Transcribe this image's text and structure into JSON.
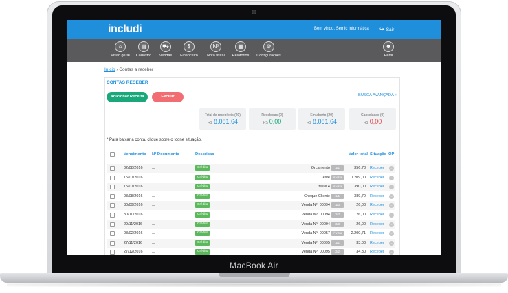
{
  "device": {
    "label": "MacBook Air"
  },
  "header": {
    "logo": "includi",
    "welcome": "Bem vindo, Semic Informática",
    "logout_label": "Sair"
  },
  "nav": [
    {
      "label": "Visão geral",
      "icon": "home-icon",
      "glyph": "⌂"
    },
    {
      "label": "Cadastro",
      "icon": "contacts-icon",
      "glyph": "▤"
    },
    {
      "label": "Vendas",
      "icon": "cart-icon",
      "glyph": "⛟"
    },
    {
      "label": "Financeiro",
      "icon": "dollar-icon",
      "glyph": "$"
    },
    {
      "label": "Nota fiscal",
      "icon": "invoice-icon",
      "glyph": "Nº"
    },
    {
      "label": "Relatórios",
      "icon": "reports-icon",
      "glyph": "▦"
    },
    {
      "label": "Configurações",
      "icon": "gear-icon",
      "glyph": "⚙"
    },
    {
      "label": "Perfil",
      "icon": "profile-icon",
      "glyph": "☻"
    }
  ],
  "breadcrumb": {
    "home": "Início",
    "current": "› Contas a receber"
  },
  "page": {
    "title": "CONTAS RECEBER",
    "add_button": "Adicionar Receita",
    "delete_button": "Excluir",
    "advanced_search": "BUSCA AVANÇADA +",
    "hint": "* Para baixar a conta, clique sobre o ícone situação."
  },
  "summary": [
    {
      "title": "Total de recebíveis (20)",
      "currency": "R$",
      "value": "8.081,64",
      "color": "#1f8fdc"
    },
    {
      "title": "Recebidas (0)",
      "currency": "R$",
      "value": "0,00",
      "color": "#1aa87a"
    },
    {
      "title": "Em aberto (20)",
      "currency": "R$",
      "value": "8.081,64",
      "color": "#1f8fdc"
    },
    {
      "title": "Canceladas (0)",
      "currency": "R$",
      "value": "0,00",
      "color": "#e0474c"
    }
  ],
  "table": {
    "headers": {
      "vencimento": "Vencimento",
      "documento": "Nº Documento",
      "descricao": "Descricao",
      "valor": "Valor total",
      "situacao": "Situação",
      "op": "OP"
    },
    "rows": [
      {
        "date": "02/08/2016",
        "doc": "...",
        "tag": "Crédito",
        "desc": "Orçamento",
        "pay": "1/1",
        "value": "356,78",
        "status": "Receber"
      },
      {
        "date": "15/07/2016",
        "doc": "...",
        "tag": "Crédito",
        "desc": "Teste",
        "pay": "À vista",
        "value": "1.209,00",
        "status": "Receber"
      },
      {
        "date": "15/07/2016",
        "doc": "...",
        "tag": "Crédito",
        "desc": "teste 4",
        "pay": "À vista",
        "value": "390,00",
        "status": "Receber"
      },
      {
        "date": "03/08/2016",
        "doc": "...",
        "tag": "Crédito",
        "desc": "Cheque Cliente",
        "pay": "1/1",
        "value": "389,70",
        "status": "Receber"
      },
      {
        "date": "30/09/2016",
        "doc": "...",
        "tag": "Crédito",
        "desc": "Venda Nº: 00094",
        "pay": "1/3",
        "value": "26,00",
        "status": "Receber"
      },
      {
        "date": "30/10/2016",
        "doc": "...",
        "tag": "Crédito",
        "desc": "Venda Nº: 00094",
        "pay": "2/3",
        "value": "26,00",
        "status": "Receber"
      },
      {
        "date": "29/11/2016",
        "doc": "...",
        "tag": "Crédito",
        "desc": "Venda Nº: 00094",
        "pay": "3/3",
        "value": "26,00",
        "status": "Receber"
      },
      {
        "date": "08/02/2016",
        "doc": "...",
        "tag": "Crédito",
        "desc": "Venda Nº: 00057",
        "pay": "À vista",
        "value": "2.200,71",
        "status": "Receber"
      },
      {
        "date": "27/11/2016",
        "doc": "...",
        "tag": "Crédito",
        "desc": "Venda Nº: 00095",
        "pay": "1/1",
        "value": "33,00",
        "status": "Receber"
      },
      {
        "date": "27/12/2016",
        "doc": "...",
        "tag": "Crédito",
        "desc": "Venda Nº: 00095",
        "pay": "2/2",
        "value": "34,30",
        "status": "Receber"
      }
    ]
  }
}
